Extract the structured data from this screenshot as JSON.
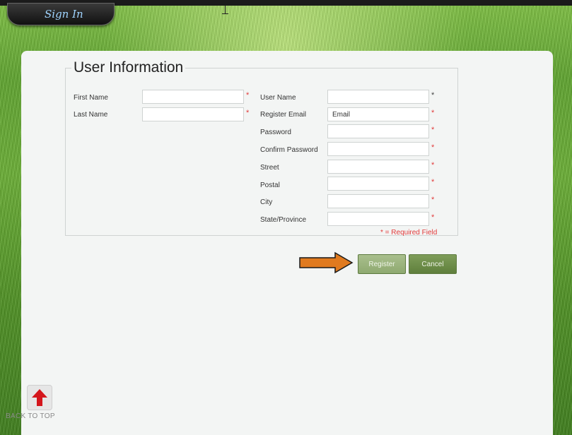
{
  "header": {
    "signin_label": "Sign In"
  },
  "form": {
    "legend": "User Information",
    "left_fields": [
      {
        "label": "First Name",
        "value": "",
        "required": true
      },
      {
        "label": "Last Name",
        "value": "",
        "required": true
      }
    ],
    "right_fields": [
      {
        "label": "User Name",
        "value": "",
        "required": true
      },
      {
        "label": "Register Email",
        "value": "Email",
        "required": true
      },
      {
        "label": "Password",
        "value": "",
        "required": true
      },
      {
        "label": "Confirm Password",
        "value": "",
        "required": true
      },
      {
        "label": "Street",
        "value": "",
        "required": true
      },
      {
        "label": "Postal",
        "value": "",
        "required": true
      },
      {
        "label": "City",
        "value": "",
        "required": true
      },
      {
        "label": "State/Province",
        "value": "",
        "required": true
      }
    ],
    "required_star": "*",
    "required_note": "* = Required Field"
  },
  "buttons": {
    "register": "Register",
    "cancel": "Cancel"
  },
  "footer": {
    "back_to_top": "BACK TO TOP"
  },
  "colors": {
    "required": "#e23b3b",
    "button_green": "#7e9d59",
    "arrow_orange": "#e07a1f"
  },
  "icons": {
    "back_to_top": "up-arrow-icon",
    "pointer": "right-arrow-icon"
  }
}
